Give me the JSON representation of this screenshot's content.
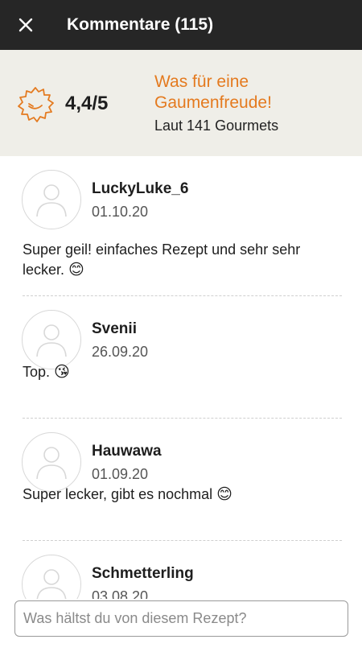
{
  "appbar": {
    "close_icon": "close-icon",
    "title": "Kommentare (115)"
  },
  "rating": {
    "badge_icon": "smiling-seal-icon",
    "score": "4,4/5",
    "verdict": "Was für eine Gaumenfreude!",
    "gourmets": "Laut 141 Gourmets",
    "accent_color": "#e47a1f"
  },
  "comments": [
    {
      "author": "LuckyLuke_6",
      "date": "01.10.20",
      "text": "Super geil! einfaches Rezept und sehr sehr lecker.",
      "emoji": "😊"
    },
    {
      "author": "Svenii",
      "date": "26.09.20",
      "text": "Top.",
      "emoji": "😘"
    },
    {
      "author": "Hauwawa",
      "date": "01.09.20",
      "text": "Super lecker, gibt es nochmal",
      "emoji": "😊"
    },
    {
      "author": "Schmetterling",
      "date": "03.08.20",
      "text": "",
      "emoji": ""
    }
  ],
  "composer": {
    "placeholder": "Was hältst du von diesem Rezept?"
  }
}
